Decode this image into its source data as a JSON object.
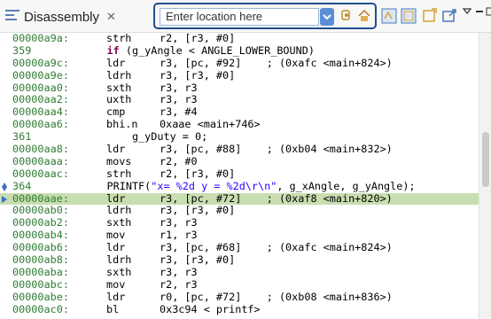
{
  "tab": {
    "title": "Disassembly",
    "close": "✕"
  },
  "location": {
    "placeholder": "Enter location here"
  },
  "colors": {
    "address": "#2e7d32",
    "keyword": "#7f0055",
    "string": "#2a00ff",
    "highlight": "#c8deb0",
    "accent": "#1f4e8c"
  },
  "rows": [
    {
      "kind": "asm",
      "addr": "00000a9a:",
      "mnem": "strh",
      "ops": "r2, [r3, #0]"
    },
    {
      "kind": "src",
      "num": "359",
      "pre": "            ",
      "kw": "if",
      "text": " (g_yAngle < ANGLE_LOWER_BOUND)"
    },
    {
      "kind": "asm",
      "addr": "00000a9c:",
      "mnem": "ldr",
      "ops": "r3, [pc, #92]    ; (0xafc <main+824>)"
    },
    {
      "kind": "asm",
      "addr": "00000a9e:",
      "mnem": "ldrh",
      "ops": "r3, [r3, #0]"
    },
    {
      "kind": "asm",
      "addr": "00000aa0:",
      "mnem": "sxth",
      "ops": "r3, r3"
    },
    {
      "kind": "asm",
      "addr": "00000aa2:",
      "mnem": "uxth",
      "ops": "r3, r3"
    },
    {
      "kind": "asm",
      "addr": "00000aa4:",
      "mnem": "cmp",
      "ops": "r3, #4"
    },
    {
      "kind": "asm",
      "addr": "00000aa6:",
      "mnem": "bhi.n",
      "ops": "0xaae <main+746>"
    },
    {
      "kind": "src",
      "num": "361",
      "pre": "                ",
      "kw": "",
      "text": "g_yDuty = 0;"
    },
    {
      "kind": "asm",
      "addr": "00000aa8:",
      "mnem": "ldr",
      "ops": "r3, [pc, #88]    ; (0xb04 <main+832>)"
    },
    {
      "kind": "asm",
      "addr": "00000aaa:",
      "mnem": "movs",
      "ops": "r2, #0"
    },
    {
      "kind": "asm",
      "addr": "00000aac:",
      "mnem": "strh",
      "ops": "r2, [r3, #0]"
    },
    {
      "kind": "src",
      "num": "364",
      "gutter": "bp",
      "pre": "            ",
      "kw": "",
      "text": "PRINTF(",
      "strlit": "\"x= %2d y = %2d\\r\\n\"",
      "tail": ", g_xAngle, g_yAngle);"
    },
    {
      "kind": "asm",
      "addr": "00000aae:",
      "mnem": "ldr",
      "ops": "r3, [pc, #72]    ; (0xaf8 <main+820>)",
      "hl": true,
      "gutter": "pc"
    },
    {
      "kind": "asm",
      "addr": "00000ab0:",
      "mnem": "ldrh",
      "ops": "r3, [r3, #0]"
    },
    {
      "kind": "asm",
      "addr": "00000ab2:",
      "mnem": "sxth",
      "ops": "r3, r3"
    },
    {
      "kind": "asm",
      "addr": "00000ab4:",
      "mnem": "mov",
      "ops": "r1, r3"
    },
    {
      "kind": "asm",
      "addr": "00000ab6:",
      "mnem": "ldr",
      "ops": "r3, [pc, #68]    ; (0xafc <main+824>)"
    },
    {
      "kind": "asm",
      "addr": "00000ab8:",
      "mnem": "ldrh",
      "ops": "r3, [r3, #0]"
    },
    {
      "kind": "asm",
      "addr": "00000aba:",
      "mnem": "sxth",
      "ops": "r3, r3"
    },
    {
      "kind": "asm",
      "addr": "00000abc:",
      "mnem": "mov",
      "ops": "r2, r3"
    },
    {
      "kind": "asm",
      "addr": "00000abe:",
      "mnem": "ldr",
      "ops": "r0, [pc, #72]    ; (0xb08 <main+836>)"
    },
    {
      "kind": "asm",
      "addr": "00000ac0:",
      "mnem": "bl",
      "ops": "0x3c94 < printf>"
    }
  ]
}
